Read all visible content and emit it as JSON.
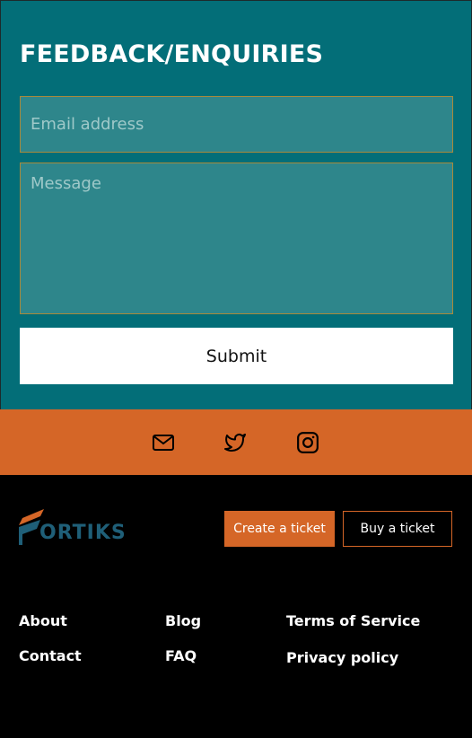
{
  "feedback": {
    "title": "FEEDBACK/ENQUIRIES",
    "email_placeholder": "Email address",
    "email_value": "",
    "message_placeholder": "Message",
    "message_value": "",
    "submit_label": "Submit"
  },
  "social": {
    "icons": [
      "mail-icon",
      "twitter-icon",
      "instagram-icon"
    ]
  },
  "footer": {
    "logo_text": "ORTIKS",
    "create_ticket_label": "Create a ticket",
    "buy_ticket_label": "Buy a ticket",
    "links": {
      "about": "About",
      "contact": "Contact",
      "blog": "Blog",
      "faq": "FAQ",
      "terms": "Terms of Service",
      "privacy": "Privacy policy"
    }
  },
  "colors": {
    "teal": "#036e78",
    "field_bg": "#2e868b",
    "orange": "#d56627",
    "logo_blue": "#1f5f78",
    "black": "#000000"
  }
}
